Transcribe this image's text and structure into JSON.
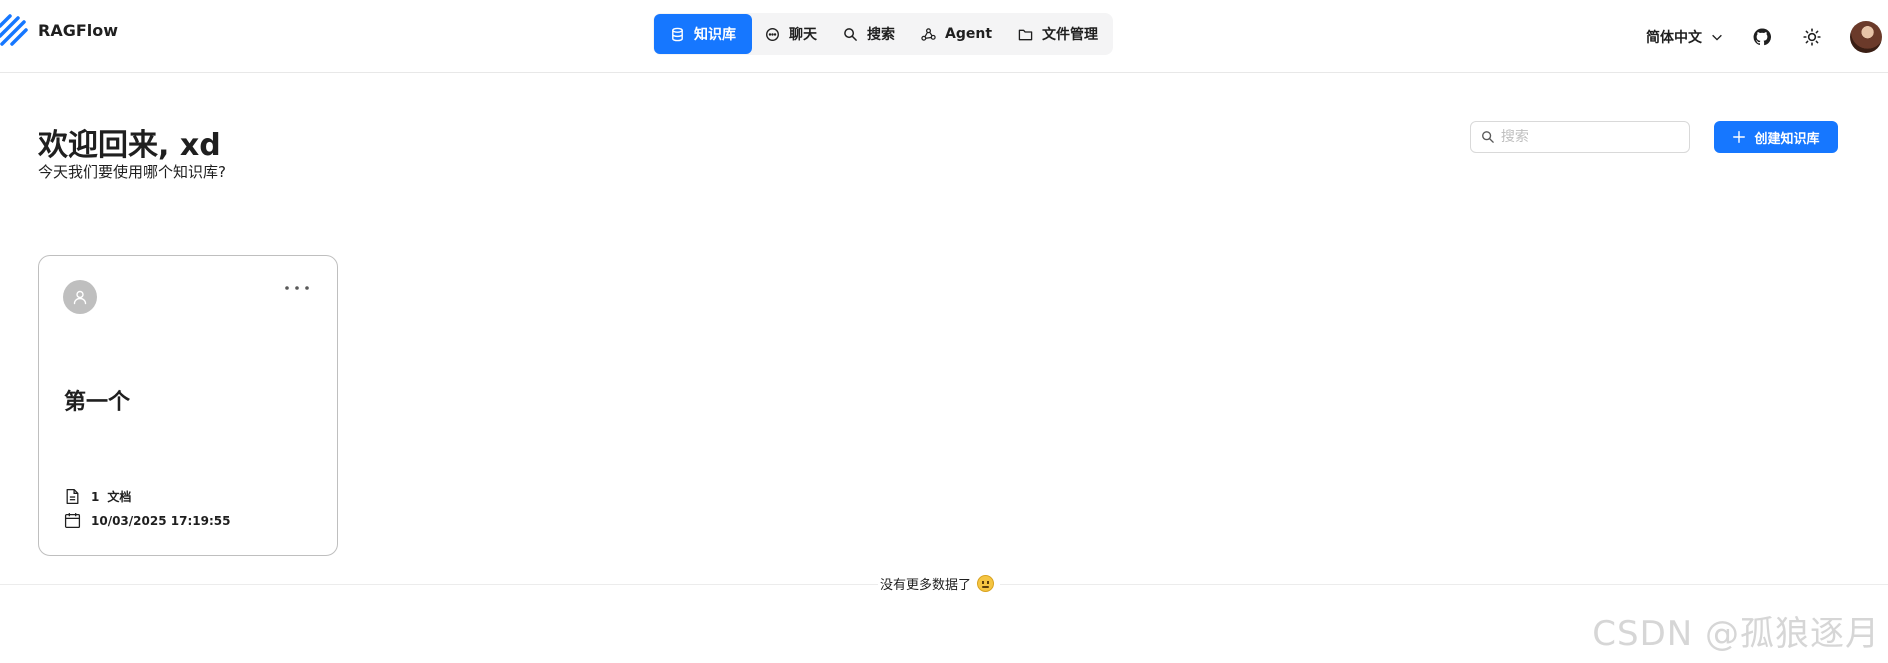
{
  "app": {
    "name": "RAGFlow",
    "brand_color": "#1677ff"
  },
  "nav": {
    "items": [
      {
        "label": "知识库",
        "icon": "database-icon",
        "active": true
      },
      {
        "label": "聊天",
        "icon": "chat-bubble-icon",
        "active": false
      },
      {
        "label": "搜索",
        "icon": "search-icon",
        "active": false
      },
      {
        "label": "Agent",
        "icon": "agent-graph-icon",
        "active": false
      },
      {
        "label": "文件管理",
        "icon": "folder-icon",
        "active": false
      }
    ]
  },
  "header": {
    "language": "简体中文",
    "github_icon": "github-icon",
    "theme_icon": "sun-icon"
  },
  "welcome": {
    "title": "欢迎回来, xd",
    "subtitle": "今天我们要使用哪个知识库?"
  },
  "search": {
    "placeholder": "搜索"
  },
  "create_button": {
    "label": "创建知识库"
  },
  "knowledge_bases": [
    {
      "title": "第一个",
      "doc_count": "1",
      "doc_label": "文档",
      "updated": "10/03/2025 17:19:55"
    }
  ],
  "footer": {
    "no_more": "没有更多数据了"
  },
  "watermark": "CSDN @孤狼逐月"
}
